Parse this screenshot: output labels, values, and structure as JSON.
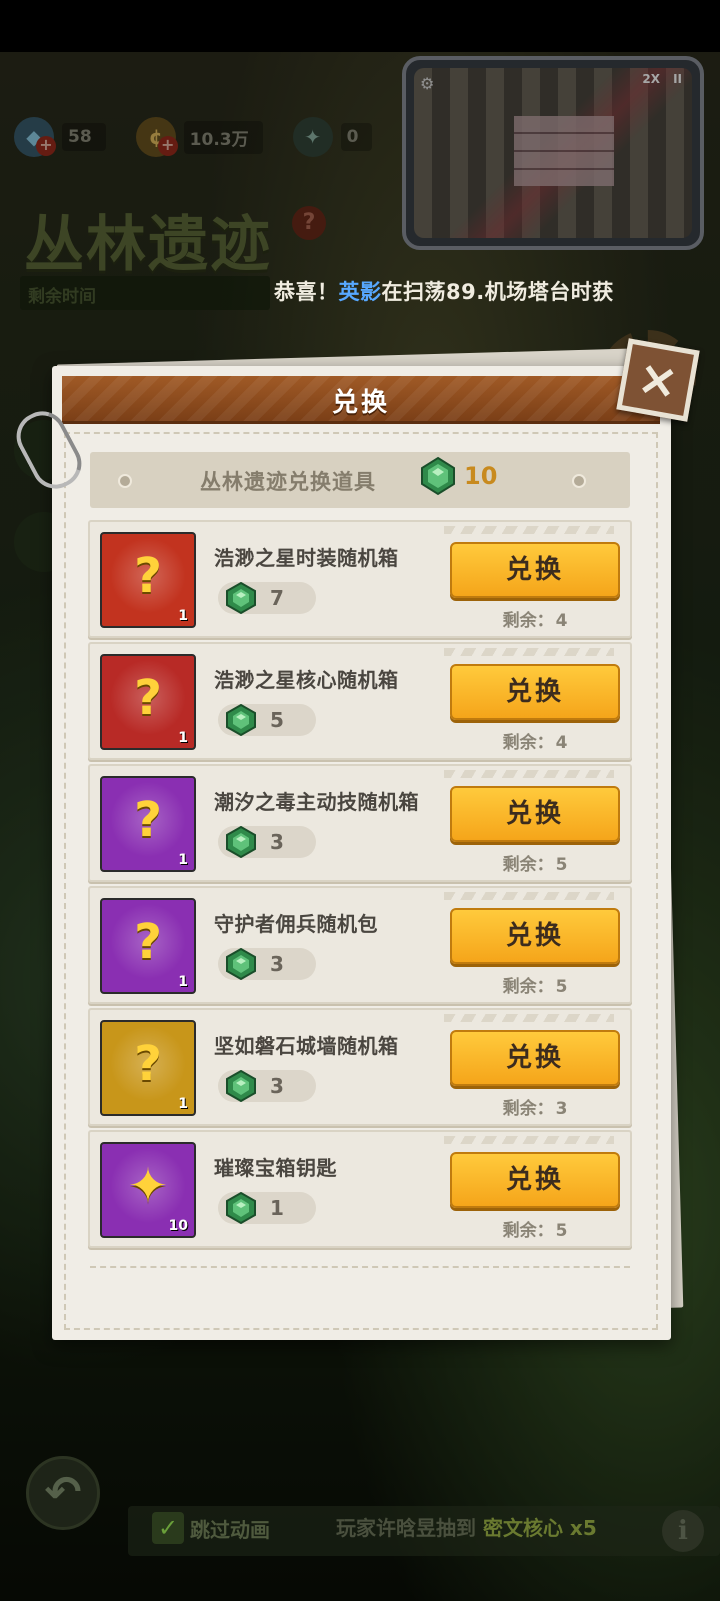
{
  "resources": [
    {
      "icon": "gem-icon",
      "value": "58"
    },
    {
      "icon": "coin-icon",
      "value": "10.3万"
    },
    {
      "icon": "token-icon",
      "value": "0"
    }
  ],
  "event": {
    "title": "丛林遗迹",
    "remain_label": "剩余时间"
  },
  "mini_window": {
    "speed": "2X",
    "pause": "II"
  },
  "ticker": {
    "prefix": "恭喜！",
    "player": "英影",
    "suffix": "在扫荡89.机场塔台时获"
  },
  "modal": {
    "title": "兑换",
    "close_symbol": "×",
    "section_title": "丛林遗迹兑换道具",
    "currency_count": "10",
    "items": [
      {
        "name": "浩渺之星时装随机箱",
        "cost": "7",
        "qty": "1",
        "button": "兑换",
        "remain_label": "剩余：",
        "remain": "4",
        "frame": "#c2331f",
        "glyph": "?"
      },
      {
        "name": "浩渺之星核心随机箱",
        "cost": "5",
        "qty": "1",
        "button": "兑换",
        "remain_label": "剩余：",
        "remain": "4",
        "frame": "#b82a26",
        "glyph": "?"
      },
      {
        "name": "潮汐之毒主动技随机箱",
        "cost": "3",
        "qty": "1",
        "button": "兑换",
        "remain_label": "剩余：",
        "remain": "5",
        "frame": "#8a2fb2",
        "glyph": "?"
      },
      {
        "name": "守护者佣兵随机包",
        "cost": "3",
        "qty": "1",
        "button": "兑换",
        "remain_label": "剩余：",
        "remain": "5",
        "frame": "#8a2fb2",
        "glyph": "?"
      },
      {
        "name": "坚如磐石城墙随机箱",
        "cost": "3",
        "qty": "1",
        "button": "兑换",
        "remain_label": "剩余：",
        "remain": "3",
        "frame": "#c8961a",
        "glyph": "?"
      },
      {
        "name": "璀璨宝箱钥匙",
        "cost": "1",
        "qty": "10",
        "button": "兑换",
        "remain_label": "剩余：",
        "remain": "5",
        "frame": "#8a2fb2",
        "glyph": "✦"
      }
    ]
  },
  "bottom": {
    "back_icon": "back-arrow-icon",
    "skip_label": "跳过动画",
    "ticker_prefix": "玩家许晗昱抽到",
    "ticker_item": "密文核心 x5",
    "info_symbol": "i"
  },
  "colors": {
    "button": "#f5a51a",
    "header": "#8a4a1c",
    "highlight_name": "#57a8ff",
    "currency": "#c88a1e"
  }
}
